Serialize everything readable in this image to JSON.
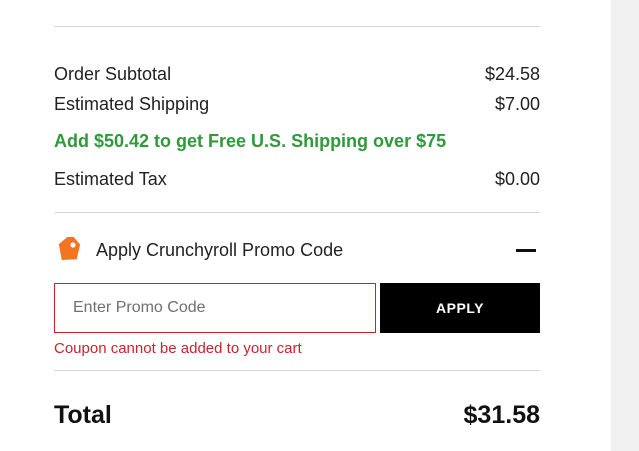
{
  "summary": {
    "subtotal_label": "Order Subtotal",
    "subtotal_value": "$24.58",
    "shipping_label": "Estimated Shipping",
    "shipping_value": "$7.00",
    "free_shipping_note": "Add $50.42 to get Free U.S. Shipping over $75",
    "tax_label": "Estimated Tax",
    "tax_value": "$0.00"
  },
  "promo": {
    "title": "Apply Crunchyroll Promo Code",
    "input_placeholder": "Enter Promo Code",
    "input_value": "",
    "apply_label": "APPLY",
    "error": "Coupon cannot be added to your cart",
    "tag_icon": "tag-icon",
    "collapse_icon": "minus-icon"
  },
  "total": {
    "label": "Total",
    "value": "$31.58"
  },
  "colors": {
    "accent_orange": "#f47521",
    "success_green": "#2e9a3a",
    "error_red": "#c8242b",
    "button_black": "#000000"
  }
}
